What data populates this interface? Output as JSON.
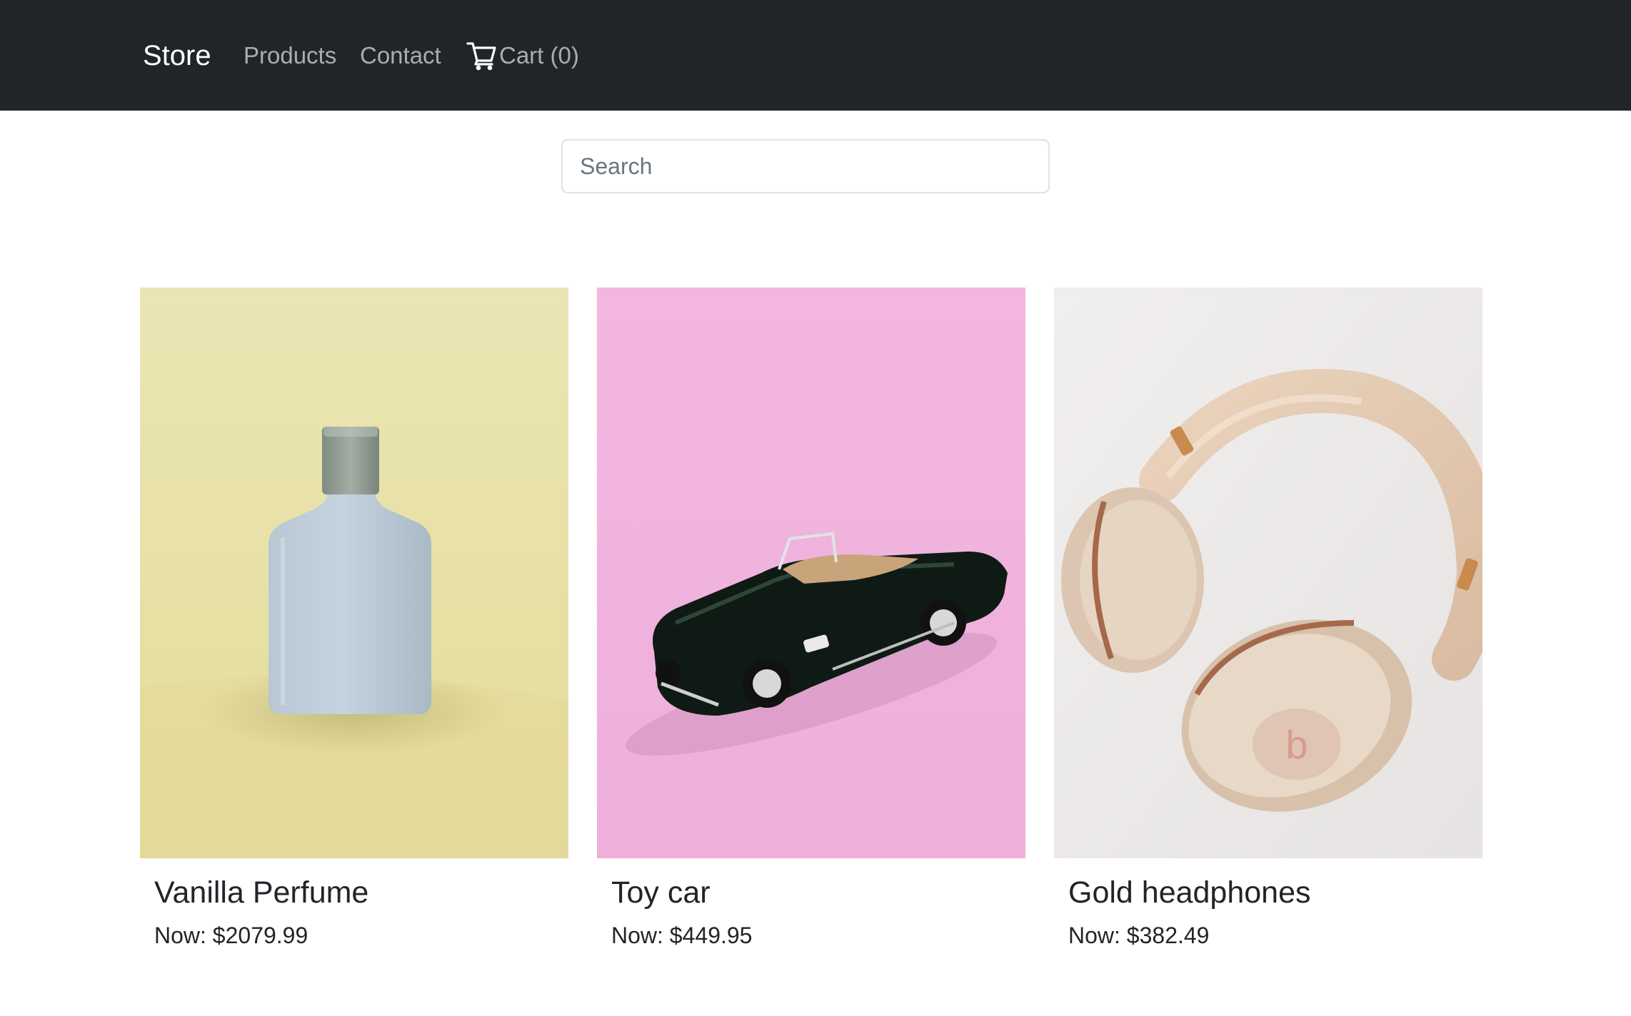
{
  "navbar": {
    "brand": "Store",
    "links": [
      {
        "label": "Products"
      },
      {
        "label": "Contact"
      }
    ],
    "cart": {
      "label": "Cart (0)",
      "icon": "cart-icon"
    }
  },
  "search": {
    "placeholder": "Search",
    "value": ""
  },
  "products": [
    {
      "title": "Vanilla Perfume",
      "price": "Now: $2079.99",
      "image": "perfume-bottle-on-yellow"
    },
    {
      "title": "Toy car",
      "price": "Now: $449.95",
      "image": "black-toy-convertible-on-pink"
    },
    {
      "title": "Gold headphones",
      "price": "Now: $382.49",
      "image": "gold-headphones-on-white"
    }
  ],
  "colors": {
    "navbar_bg": "#212529",
    "nav_link": "#9a9da0",
    "brand": "#ffffff",
    "text": "#212529"
  }
}
